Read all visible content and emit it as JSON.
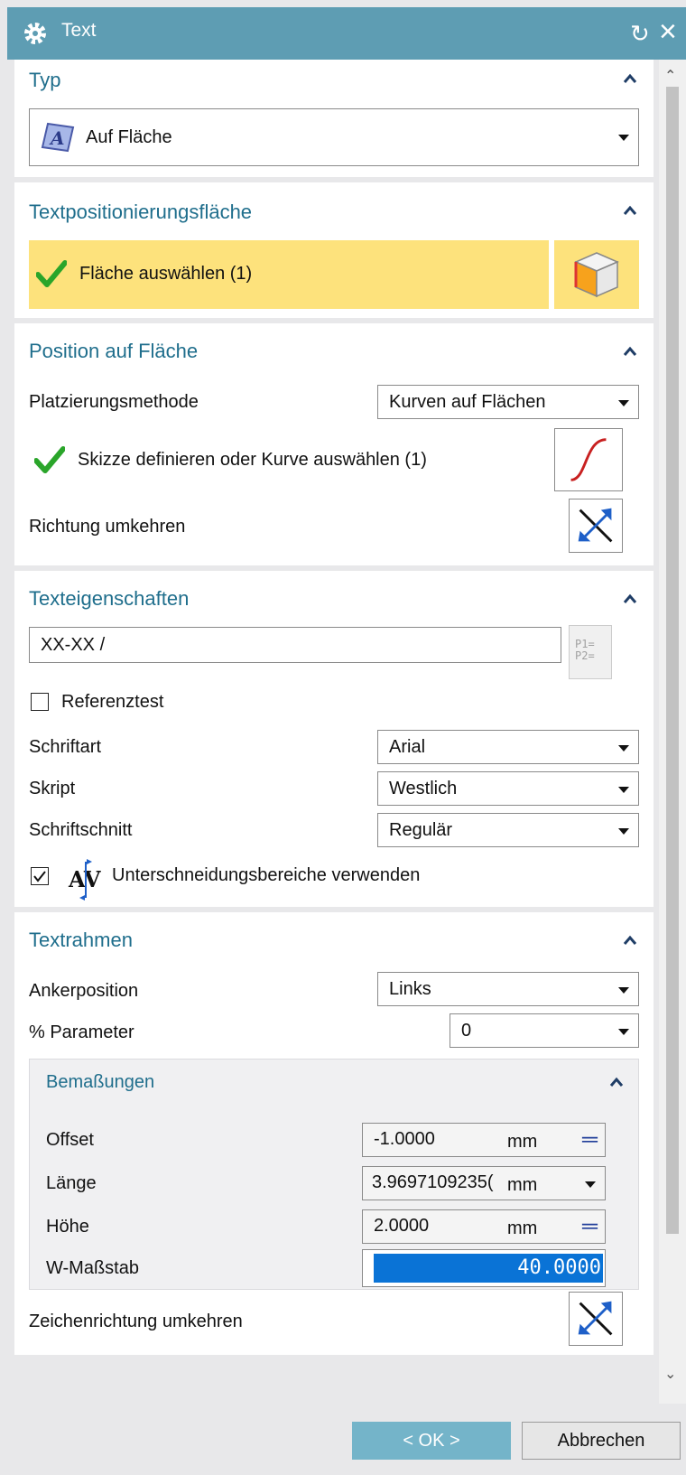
{
  "window": {
    "title": "Text"
  },
  "typ": {
    "title": "Typ",
    "dropdown": "Auf Fläche"
  },
  "surface": {
    "title": "Textpositionierungsfläche",
    "select_label": "Fläche auswählen (1)",
    "highlight_color": "#fde27c"
  },
  "position": {
    "title": "Position auf Fläche",
    "method_label": "Platzierungsmethode",
    "method_value": "Kurven auf Flächen",
    "curve_label": "Skizze definieren oder Kurve auswählen (1)",
    "reverse_label": "Richtung umkehren"
  },
  "properties": {
    "title": "Texteigenschaften",
    "text_value": "XX-XX /",
    "param_icon": "P1=\nP2=",
    "reference_label": "Referenztest",
    "reference_checked": false,
    "font_label": "Schriftart",
    "font_value": "Arial",
    "script_label": "Skript",
    "script_value": "Westlich",
    "style_label": "Schriftschnitt",
    "style_value": "Regulär",
    "kerning_label": "Unterschneidungsbereiche verwenden",
    "kerning_checked": true
  },
  "frame": {
    "title": "Textrahmen",
    "anchor_label": "Ankerposition",
    "anchor_value": "Links",
    "param_label": "% Parameter",
    "param_value": "0",
    "dims": {
      "title": "Bemaßungen",
      "offset_label": "Offset",
      "offset_value": "-1.0000",
      "offset_unit": "mm",
      "length_label": "Länge",
      "length_value": "3.9697109235(",
      "length_unit": "mm",
      "height_label": "Höhe",
      "height_value": "2.0000",
      "height_unit": "mm",
      "wscale_label": "W-Maßstab",
      "wscale_value": "40.0000"
    },
    "reverse_char_label": "Zeichenrichtung umkehren"
  },
  "buttons": {
    "ok": "< OK >",
    "cancel": "Abbrechen"
  },
  "colors": {
    "titlebar": "#5e9db3",
    "accent": "#1f6e8c",
    "selection": "#0a73d6"
  }
}
